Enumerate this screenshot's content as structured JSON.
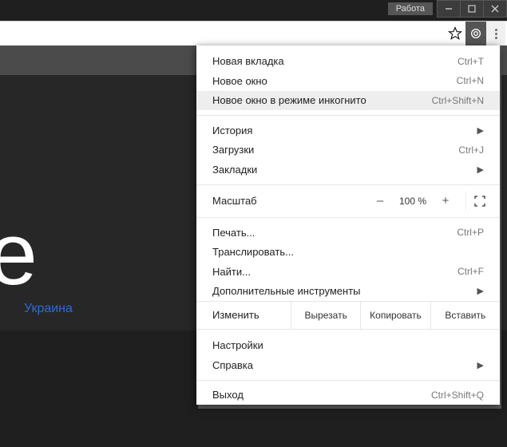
{
  "titlebar": {
    "workspace": "Работа"
  },
  "page": {
    "logo_fragment": "gle",
    "country": "Украина"
  },
  "menu": {
    "new_tab": {
      "label": "Новая вкладка",
      "shortcut": "Ctrl+T"
    },
    "new_window": {
      "label": "Новое окно",
      "shortcut": "Ctrl+N"
    },
    "incognito": {
      "label": "Новое окно в режиме инкогнито",
      "shortcut": "Ctrl+Shift+N"
    },
    "history": {
      "label": "История"
    },
    "downloads": {
      "label": "Загрузки",
      "shortcut": "Ctrl+J"
    },
    "bookmarks": {
      "label": "Закладки"
    },
    "zoom_label": "Масштаб",
    "zoom_minus": "–",
    "zoom_value": "100 %",
    "zoom_plus": "+",
    "print": {
      "label": "Печать...",
      "shortcut": "Ctrl+P"
    },
    "cast": {
      "label": "Транслировать..."
    },
    "find": {
      "label": "Найти...",
      "shortcut": "Ctrl+F"
    },
    "more_tools": {
      "label": "Дополнительные инструменты"
    },
    "edit_label": "Изменить",
    "edit_cut": "Вырезать",
    "edit_copy": "Копировать",
    "edit_paste": "Вставить",
    "settings": {
      "label": "Настройки"
    },
    "help": {
      "label": "Справка"
    },
    "exit": {
      "label": "Выход",
      "shortcut": "Ctrl+Shift+Q"
    }
  }
}
